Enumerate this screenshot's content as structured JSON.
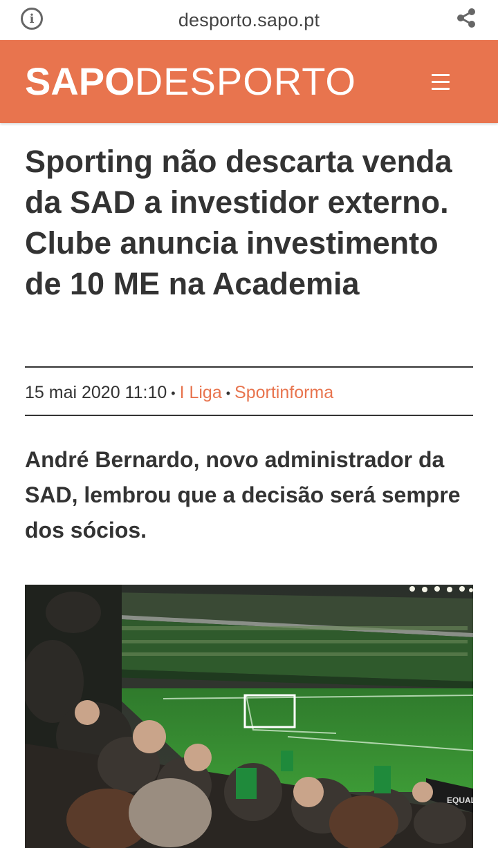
{
  "browser": {
    "url": "desporto.sapo.pt",
    "info_icon": "info-icon",
    "share_icon": "share-icon"
  },
  "header": {
    "logo_bold": "SAPO",
    "logo_light": "DESPORTO",
    "menu_icon": "hamburger-menu-icon",
    "background_color": "#e8744e"
  },
  "article": {
    "title": "Sporting não descarta venda da SAD a investidor externo. Clube anuncia investimento de 10 ME na Academia",
    "date": "15 mai 2020 11:10",
    "category": "I Liga",
    "source": "Sportinforma",
    "lead": "André Bernardo, novo administrador da SAD, lembrou que a decisão será sempre dos sócios.",
    "accent_color": "#e8744e"
  }
}
